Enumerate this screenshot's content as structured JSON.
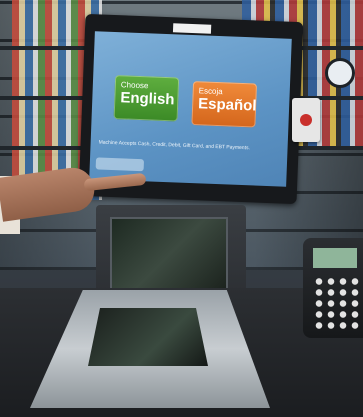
{
  "photo": {
    "description_alt": "",
    "bezel_label": "",
    "screen": {
      "english_button": {
        "line1": "Choose",
        "line2": "English"
      },
      "espanol_button": {
        "line1": "Escoja",
        "line2": "Español"
      },
      "note": "Machine Accepts Cash, Credit, Debit, Gift Card, and EBT Payments."
    }
  },
  "colors": {
    "screen_blue": "#5c93c4",
    "english_green": "#3b8a26",
    "espanol_orange": "#d4661c"
  }
}
